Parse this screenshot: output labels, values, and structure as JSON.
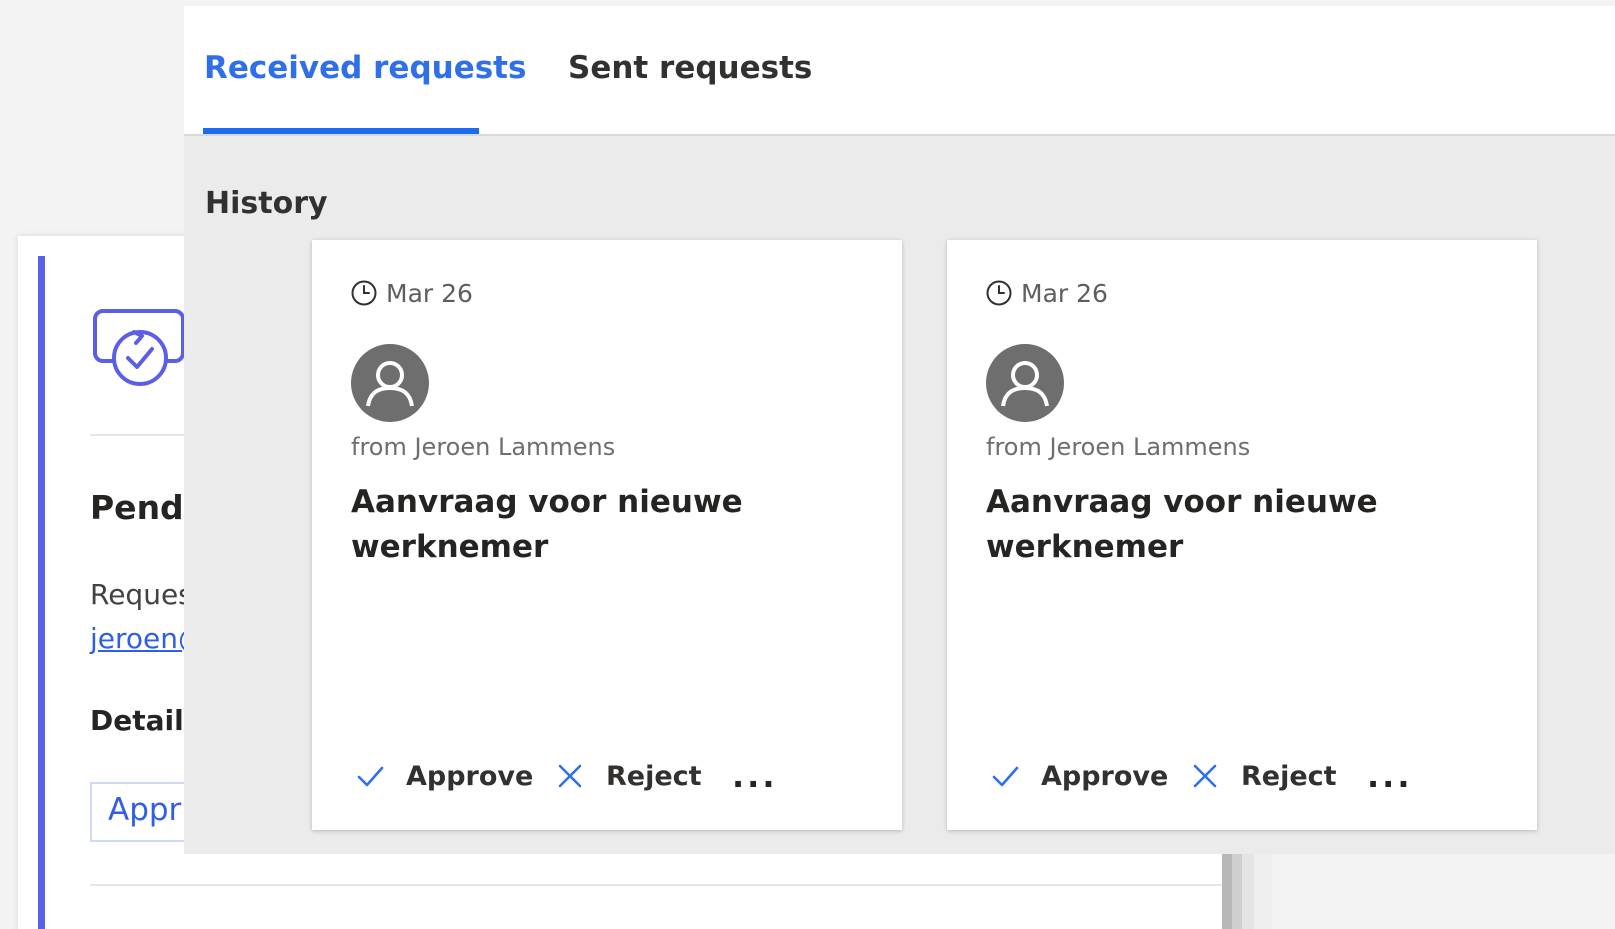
{
  "background_panel": {
    "status_text": "Pendi",
    "requester_label": "Reques",
    "requester_email": "jeroen@",
    "details_label": "Details:",
    "approve_button_label": "Appr",
    "accent_color": "#5b5fe6",
    "logo_icon": "approval-check-icon"
  },
  "tabs": [
    {
      "label": "Received requests",
      "active": true
    },
    {
      "label": "Sent requests",
      "active": false
    }
  ],
  "section_title": "History",
  "accent_color": "#1f6bf0",
  "cards": [
    {
      "date": "Mar 26",
      "from": "from Jeroen Lammens",
      "title": "Aanvraag voor nieuwe werknemer",
      "approve_label": "Approve",
      "reject_label": "Reject",
      "more_label": "..."
    },
    {
      "date": "Mar 26",
      "from": "from Jeroen Lammens",
      "title": "Aanvraag voor nieuwe werknemer",
      "approve_label": "Approve",
      "reject_label": "Reject",
      "more_label": "..."
    }
  ]
}
